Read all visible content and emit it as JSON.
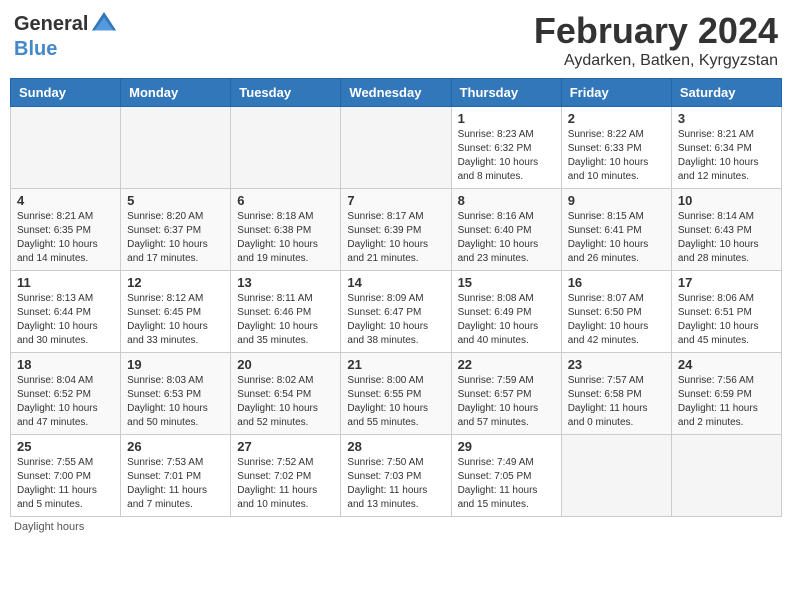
{
  "header": {
    "logo_general": "General",
    "logo_blue": "Blue",
    "title": "February 2024",
    "subtitle": "Aydarken, Batken, Kyrgyzstan"
  },
  "days_of_week": [
    "Sunday",
    "Monday",
    "Tuesday",
    "Wednesday",
    "Thursday",
    "Friday",
    "Saturday"
  ],
  "weeks": [
    [
      {
        "day": "",
        "info": ""
      },
      {
        "day": "",
        "info": ""
      },
      {
        "day": "",
        "info": ""
      },
      {
        "day": "",
        "info": ""
      },
      {
        "day": "1",
        "info": "Sunrise: 8:23 AM\nSunset: 6:32 PM\nDaylight: 10 hours and 8 minutes."
      },
      {
        "day": "2",
        "info": "Sunrise: 8:22 AM\nSunset: 6:33 PM\nDaylight: 10 hours and 10 minutes."
      },
      {
        "day": "3",
        "info": "Sunrise: 8:21 AM\nSunset: 6:34 PM\nDaylight: 10 hours and 12 minutes."
      }
    ],
    [
      {
        "day": "4",
        "info": "Sunrise: 8:21 AM\nSunset: 6:35 PM\nDaylight: 10 hours and 14 minutes."
      },
      {
        "day": "5",
        "info": "Sunrise: 8:20 AM\nSunset: 6:37 PM\nDaylight: 10 hours and 17 minutes."
      },
      {
        "day": "6",
        "info": "Sunrise: 8:18 AM\nSunset: 6:38 PM\nDaylight: 10 hours and 19 minutes."
      },
      {
        "day": "7",
        "info": "Sunrise: 8:17 AM\nSunset: 6:39 PM\nDaylight: 10 hours and 21 minutes."
      },
      {
        "day": "8",
        "info": "Sunrise: 8:16 AM\nSunset: 6:40 PM\nDaylight: 10 hours and 23 minutes."
      },
      {
        "day": "9",
        "info": "Sunrise: 8:15 AM\nSunset: 6:41 PM\nDaylight: 10 hours and 26 minutes."
      },
      {
        "day": "10",
        "info": "Sunrise: 8:14 AM\nSunset: 6:43 PM\nDaylight: 10 hours and 28 minutes."
      }
    ],
    [
      {
        "day": "11",
        "info": "Sunrise: 8:13 AM\nSunset: 6:44 PM\nDaylight: 10 hours and 30 minutes."
      },
      {
        "day": "12",
        "info": "Sunrise: 8:12 AM\nSunset: 6:45 PM\nDaylight: 10 hours and 33 minutes."
      },
      {
        "day": "13",
        "info": "Sunrise: 8:11 AM\nSunset: 6:46 PM\nDaylight: 10 hours and 35 minutes."
      },
      {
        "day": "14",
        "info": "Sunrise: 8:09 AM\nSunset: 6:47 PM\nDaylight: 10 hours and 38 minutes."
      },
      {
        "day": "15",
        "info": "Sunrise: 8:08 AM\nSunset: 6:49 PM\nDaylight: 10 hours and 40 minutes."
      },
      {
        "day": "16",
        "info": "Sunrise: 8:07 AM\nSunset: 6:50 PM\nDaylight: 10 hours and 42 minutes."
      },
      {
        "day": "17",
        "info": "Sunrise: 8:06 AM\nSunset: 6:51 PM\nDaylight: 10 hours and 45 minutes."
      }
    ],
    [
      {
        "day": "18",
        "info": "Sunrise: 8:04 AM\nSunset: 6:52 PM\nDaylight: 10 hours and 47 minutes."
      },
      {
        "day": "19",
        "info": "Sunrise: 8:03 AM\nSunset: 6:53 PM\nDaylight: 10 hours and 50 minutes."
      },
      {
        "day": "20",
        "info": "Sunrise: 8:02 AM\nSunset: 6:54 PM\nDaylight: 10 hours and 52 minutes."
      },
      {
        "day": "21",
        "info": "Sunrise: 8:00 AM\nSunset: 6:55 PM\nDaylight: 10 hours and 55 minutes."
      },
      {
        "day": "22",
        "info": "Sunrise: 7:59 AM\nSunset: 6:57 PM\nDaylight: 10 hours and 57 minutes."
      },
      {
        "day": "23",
        "info": "Sunrise: 7:57 AM\nSunset: 6:58 PM\nDaylight: 11 hours and 0 minutes."
      },
      {
        "day": "24",
        "info": "Sunrise: 7:56 AM\nSunset: 6:59 PM\nDaylight: 11 hours and 2 minutes."
      }
    ],
    [
      {
        "day": "25",
        "info": "Sunrise: 7:55 AM\nSunset: 7:00 PM\nDaylight: 11 hours and 5 minutes."
      },
      {
        "day": "26",
        "info": "Sunrise: 7:53 AM\nSunset: 7:01 PM\nDaylight: 11 hours and 7 minutes."
      },
      {
        "day": "27",
        "info": "Sunrise: 7:52 AM\nSunset: 7:02 PM\nDaylight: 11 hours and 10 minutes."
      },
      {
        "day": "28",
        "info": "Sunrise: 7:50 AM\nSunset: 7:03 PM\nDaylight: 11 hours and 13 minutes."
      },
      {
        "day": "29",
        "info": "Sunrise: 7:49 AM\nSunset: 7:05 PM\nDaylight: 11 hours and 15 minutes."
      },
      {
        "day": "",
        "info": ""
      },
      {
        "day": "",
        "info": ""
      }
    ]
  ],
  "footer": {
    "note": "Daylight hours"
  }
}
